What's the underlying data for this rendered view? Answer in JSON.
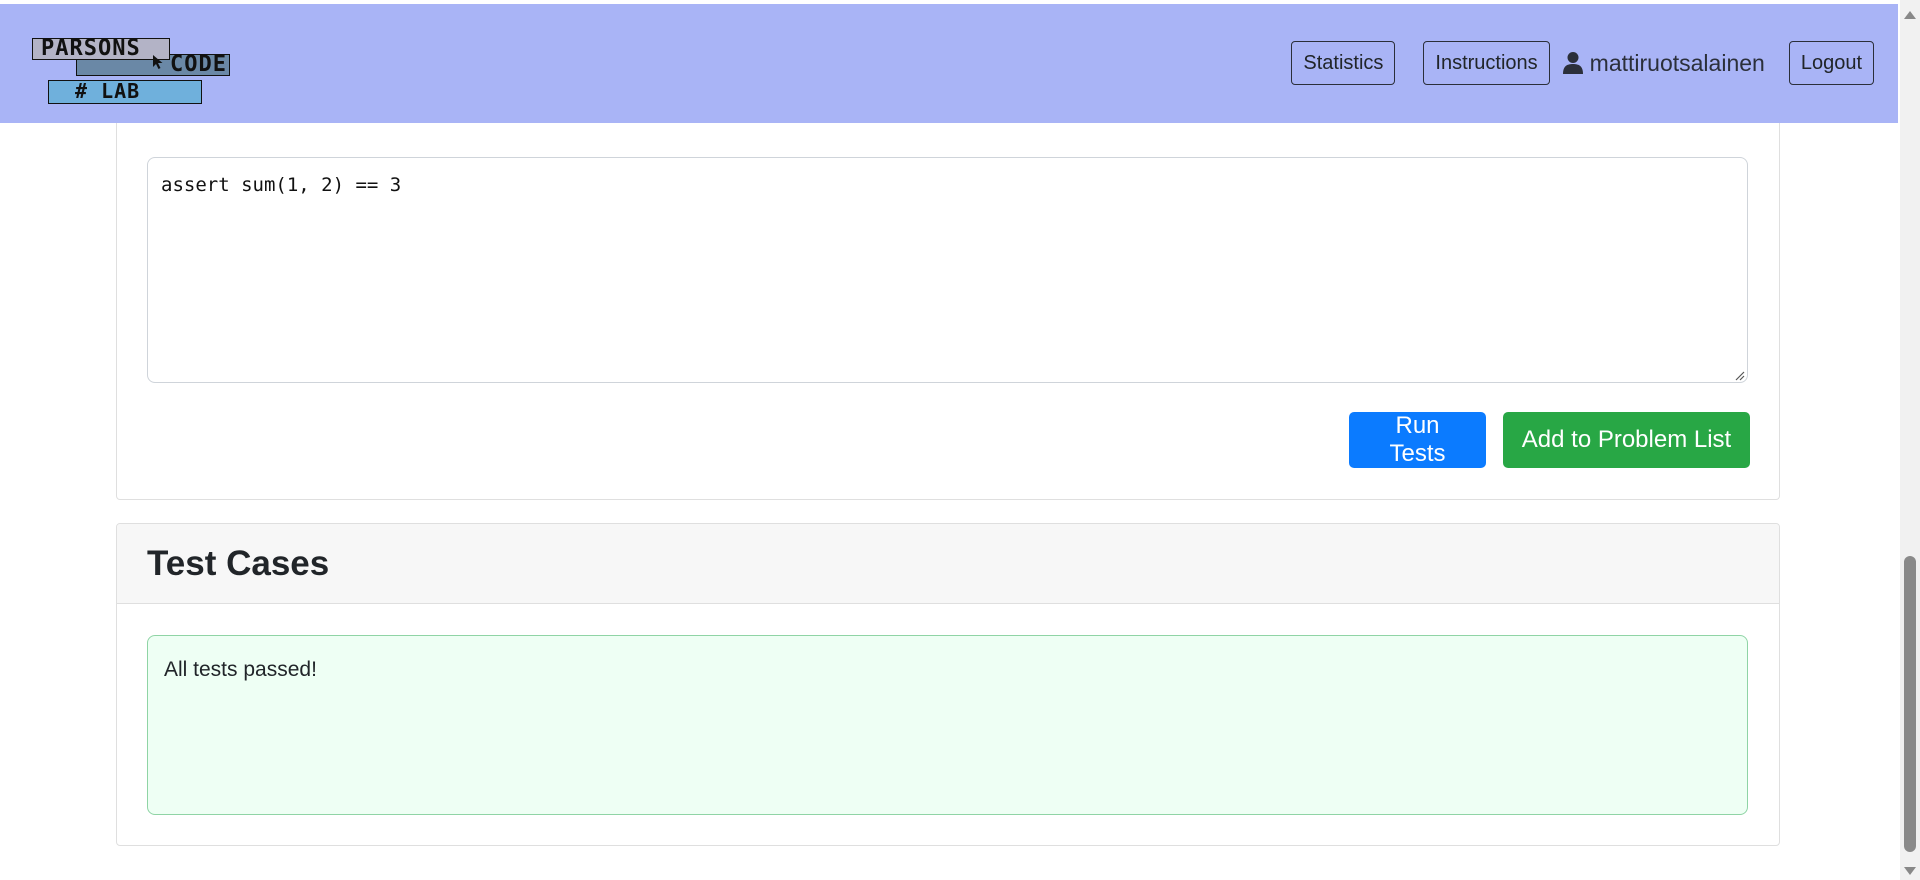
{
  "brand": {
    "logo_line1": "PARSONS",
    "logo_line2": "CODE",
    "logo_line3": "# LAB"
  },
  "nav": {
    "statistics_label": "Statistics",
    "instructions_label": "Instructions",
    "username": "mattiruotsalainen",
    "logout_label": "Logout",
    "user_icon": "user-icon"
  },
  "editor": {
    "code": "assert sum(1, 2) == 3"
  },
  "actions": {
    "run_tests_label": "Run Tests",
    "add_to_problem_list_label": "Add to Problem List"
  },
  "tests": {
    "title": "Test Cases",
    "result": "All tests passed!"
  },
  "colors": {
    "navbar": "#a9b4f6",
    "run_button": "#0b7bff",
    "add_button": "#28a745",
    "success_bg": "#eefff4",
    "success_border": "#8fd4a5"
  }
}
